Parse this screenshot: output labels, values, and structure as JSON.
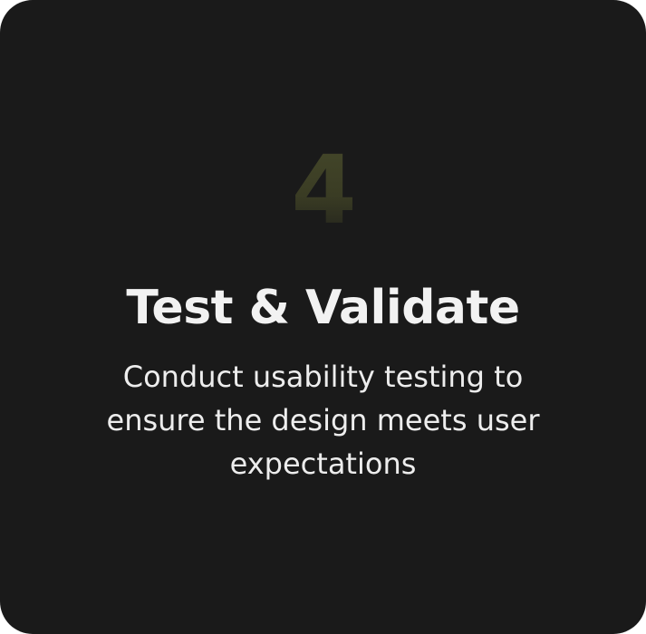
{
  "card": {
    "step_number": "4",
    "title": "Test & Validate",
    "description": "Conduct usability testing to ensure the design meets user expectations"
  },
  "colors": {
    "card_background": "#1a1a1a",
    "number_olive": "#3e4024",
    "title_text": "#f2f2f2",
    "body_text": "#ededed"
  }
}
